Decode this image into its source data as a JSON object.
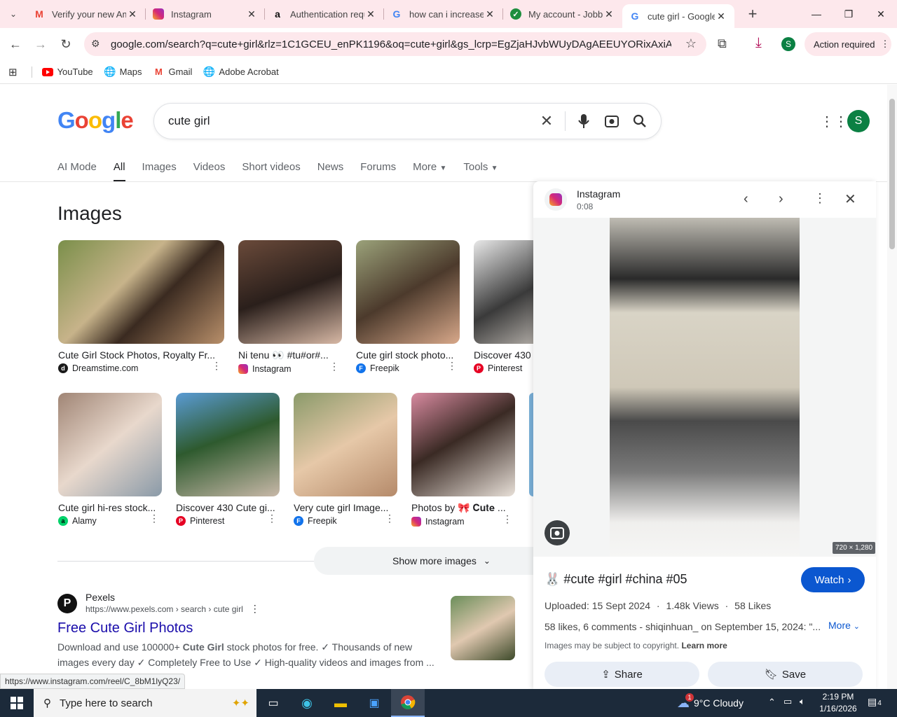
{
  "tabs": [
    {
      "title": "Verify your new Ama",
      "favicon": "gmail-icon",
      "active": false
    },
    {
      "title": "Instagram",
      "favicon": "instagram-icon",
      "active": false
    },
    {
      "title": "Authentication requ",
      "favicon": "amazon-icon",
      "active": false
    },
    {
      "title": "how can i increase",
      "favicon": "google-icon",
      "active": false
    },
    {
      "title": "My account - Jobb",
      "favicon": "jobb-icon",
      "active": false
    },
    {
      "title": "cute girl - Google S",
      "favicon": "google-icon",
      "active": true
    }
  ],
  "toolbar": {
    "url": "google.com/search?q=cute+girl&rlz=1C1GCEU_enPK1196&oq=cute+girl&gs_lcrp=EgZjaHJvbWUyDAgAEEUYORixAxiABDIKCAE...",
    "profile_letter": "S",
    "action_required": "Action required"
  },
  "bookmarks": [
    {
      "label": "YouTube",
      "icon": "youtube-icon"
    },
    {
      "label": "Maps",
      "icon": "maps-icon"
    },
    {
      "label": "Gmail",
      "icon": "gmail-icon"
    },
    {
      "label": "Adobe Acrobat",
      "icon": "acrobat-icon"
    }
  ],
  "search": {
    "logo": "Google",
    "query": "cute girl",
    "avatar_letter": "S"
  },
  "nav_tabs": [
    "AI Mode",
    "All",
    "Images",
    "Videos",
    "Short videos",
    "News",
    "Forums",
    "More",
    "Tools"
  ],
  "images_heading": "Images",
  "image_row1": [
    {
      "title": "Cute Girl Stock Photos, Royalty Fr...",
      "source": "Dreamstime.com",
      "src_color": "#1a1a1a"
    },
    {
      "title": "Ni tenu 👀 #tu#or#...",
      "source": "Instagram",
      "src_color": "#d62976"
    },
    {
      "title": "Cute girl stock photo...",
      "source": "Freepik",
      "src_color": "#1273eb"
    },
    {
      "title": "Discover 430",
      "source": "Pinterest",
      "src_color": "#e60023"
    }
  ],
  "image_row2": [
    {
      "title": "Cute girl hi-res stock...",
      "source": "Alamy",
      "src_color": "#00d26a"
    },
    {
      "title": "Discover 430 Cute gi...",
      "source": "Pinterest",
      "src_color": "#e60023"
    },
    {
      "title": "Very cute girl Image...",
      "source": "Freepik",
      "src_color": "#1273eb"
    },
    {
      "title": "Photos by 🎀 𝐂𝐮𝐭𝐞 ...",
      "source": "Instagram",
      "src_color": "#d62976"
    }
  ],
  "show_more": "Show more images",
  "result": {
    "site": "Pexels",
    "breadcrumb": "https://www.pexels.com › search › cute girl",
    "title": "Free Cute Girl Photos",
    "snippet_1": "Download and use 100000+ ",
    "snippet_bold": "Cute Girl",
    "snippet_2": " stock photos for free. ✓ Thousands of new",
    "snippet_line2": "images every day ✓ Completely Free to Use ✓ High-quality videos and images from ..."
  },
  "panel": {
    "source": "Instagram",
    "duration": "0:08",
    "dimensions": "720 × 1,280",
    "title": "🐰 #cute #girl #china #05",
    "watch": "Watch",
    "uploaded": "Uploaded: 15 Sept 2024",
    "views": "1.48k Views",
    "likes": "58 Likes",
    "description": "58 likes, 6 comments - shiqinhuan_ on September 15, 2024: \"...",
    "more": "More",
    "copyright": "Images may be subject to copyright.",
    "learn_more": "Learn more",
    "share": "Share",
    "save": "Save"
  },
  "status_url": "https://www.instagram.com/reel/C_8bM1lyQ23/",
  "taskbar": {
    "search_placeholder": "Type here to search",
    "weather": "9°C  Cloudy",
    "weather_badge": "1",
    "time": "2:19 PM",
    "date": "1/16/2026",
    "notifications": "4"
  }
}
